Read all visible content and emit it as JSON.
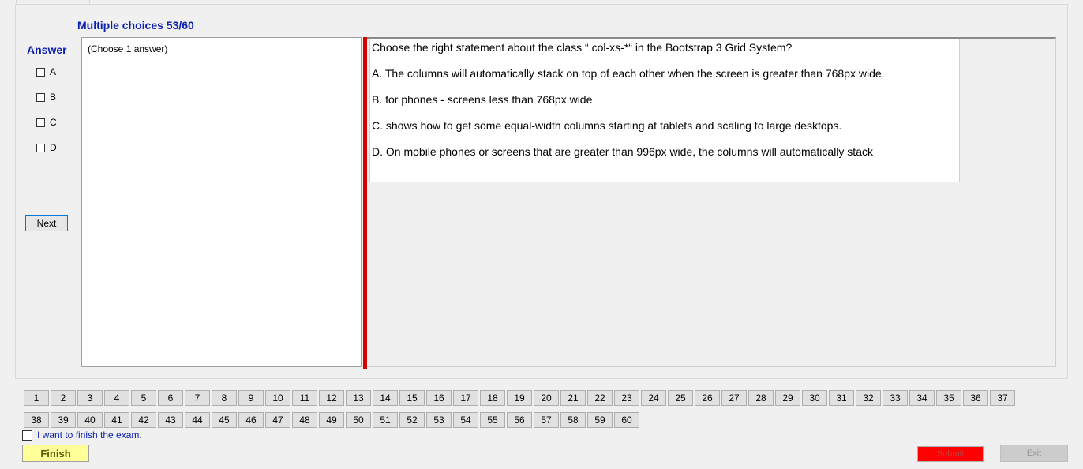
{
  "header": {
    "title": "Multiple choices 53/60"
  },
  "answer": {
    "label": "Answer",
    "options": [
      "A",
      "B",
      "C",
      "D"
    ],
    "next_label": "Next"
  },
  "left_panel": {
    "instruction": "(Choose 1 answer)"
  },
  "question": {
    "text": "Choose the right statement about the class “.col-xs-*“ in the Bootstrap 3 Grid System?",
    "choices": [
      "A.  The columns will automatically stack on top of each other when the screen is greater than 768px wide.",
      "B.  for phones - screens less than 768px wide",
      "C.  shows how to get some equal-width columns starting at tablets and scaling to large desktops.",
      "D.  On mobile phones or screens that are greater than 996px wide, the columns will automatically stack"
    ]
  },
  "nav": {
    "row1": [
      "1",
      "2",
      "3",
      "4",
      "5",
      "6",
      "7",
      "8",
      "9",
      "10",
      "11",
      "12",
      "13",
      "14",
      "15",
      "16",
      "17",
      "18",
      "19",
      "20",
      "21",
      "22",
      "23",
      "24",
      "25",
      "26",
      "27",
      "28",
      "29",
      "30",
      "31",
      "32",
      "33",
      "34",
      "35",
      "36",
      "37"
    ],
    "row2": [
      "38",
      "39",
      "40",
      "41",
      "42",
      "43",
      "44",
      "45",
      "46",
      "47",
      "48",
      "49",
      "50",
      "51",
      "52",
      "53",
      "54",
      "55",
      "56",
      "57",
      "58",
      "59",
      "60"
    ]
  },
  "footer": {
    "finish_check_label": "I want to finish the exam.",
    "finish_label": "Finish",
    "submit_label": "Submit",
    "exit_label": "Exit"
  },
  "colors": {
    "accent": "#0a1fb0",
    "red_bar": "#d50000",
    "finish_bg": "#ffff99",
    "submit_bg": "#ff0000"
  }
}
